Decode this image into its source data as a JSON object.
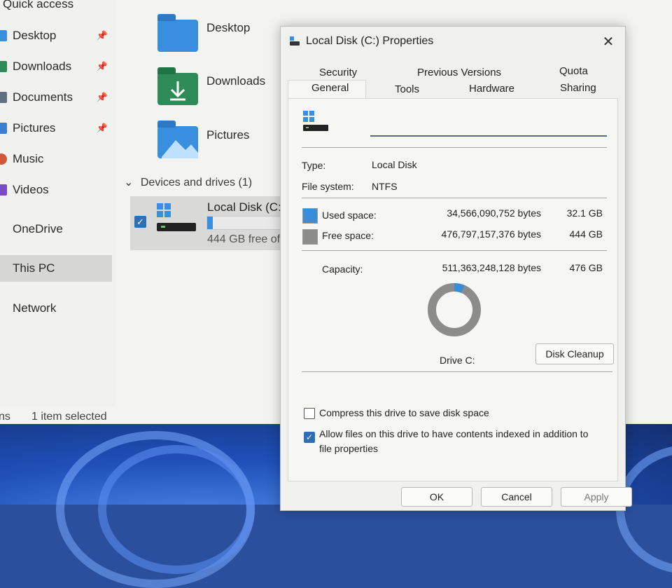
{
  "explorer": {
    "nav": {
      "quick_access": "Quick access",
      "items": [
        {
          "label": "Desktop",
          "icon": "desktop-icon",
          "color": "#3a8ee0",
          "pinned": true
        },
        {
          "label": "Downloads",
          "icon": "download-icon",
          "color": "#2e8b57",
          "pinned": true
        },
        {
          "label": "Documents",
          "icon": "documents-icon",
          "color": "#607080",
          "pinned": true
        },
        {
          "label": "Pictures",
          "icon": "pictures-icon",
          "color": "#3a7fd0",
          "pinned": true
        },
        {
          "label": "Music",
          "icon": "music-icon",
          "color": "#d0583a",
          "pinned": false
        },
        {
          "label": "Videos",
          "icon": "videos-icon",
          "color": "#7a4bc8",
          "pinned": false
        },
        {
          "label": "OneDrive",
          "icon": "onedrive-icon",
          "color": "#2f6fb5",
          "pinned": false
        },
        {
          "label": "This PC",
          "icon": "pc-icon",
          "color": "#3a7fd0",
          "pinned": false,
          "selected": true
        },
        {
          "label": "Network",
          "icon": "network-icon",
          "color": "#3a7fd0",
          "pinned": false
        }
      ],
      "pin_glyph": "📌"
    },
    "folders": [
      {
        "label": "Desktop",
        "color": "#3a8ee0"
      },
      {
        "label": "Downloads",
        "color": "#2e8b57"
      },
      {
        "label": "Pictures",
        "color": "#3a8ee0"
      }
    ],
    "devices_header": "Devices and drives (1)",
    "drive": {
      "name": "Local Disk (C:)",
      "free_text": "444 GB free of",
      "used_fraction": 0.063
    },
    "status": {
      "left": "ns",
      "selected": "1 item selected"
    }
  },
  "dialog": {
    "title": "Local Disk (C:) Properties",
    "close": "✕",
    "tabs_row1": [
      "Security",
      "Previous Versions",
      "Quota"
    ],
    "tabs_row2": [
      "General",
      "Tools",
      "Hardware",
      "Sharing"
    ],
    "active_tab": "General",
    "name_value": "",
    "type_label": "Type:",
    "type_value": "Local Disk",
    "fs_label": "File system:",
    "fs_value": "NTFS",
    "used": {
      "label": "Used space:",
      "bytes": "34,566,090,752 bytes",
      "size": "32.1 GB",
      "color": "#3a8ed8"
    },
    "free": {
      "label": "Free space:",
      "bytes": "476,797,157,376 bytes",
      "size": "444 GB",
      "color": "#8c8c8a"
    },
    "capacity": {
      "label": "Capacity:",
      "bytes": "511,363,248,128 bytes",
      "size": "476 GB"
    },
    "used_fraction": 0.063,
    "drive_label": "Drive C:",
    "cleanup_button": "Disk Cleanup",
    "compress": {
      "label": "Compress this drive to save disk space",
      "checked": false
    },
    "index": {
      "label_line1": "Allow files on this drive to have contents indexed in addition to",
      "label_line2": "file properties",
      "checked": true
    },
    "buttons": {
      "ok": "OK",
      "cancel": "Cancel",
      "apply": "Apply"
    }
  }
}
